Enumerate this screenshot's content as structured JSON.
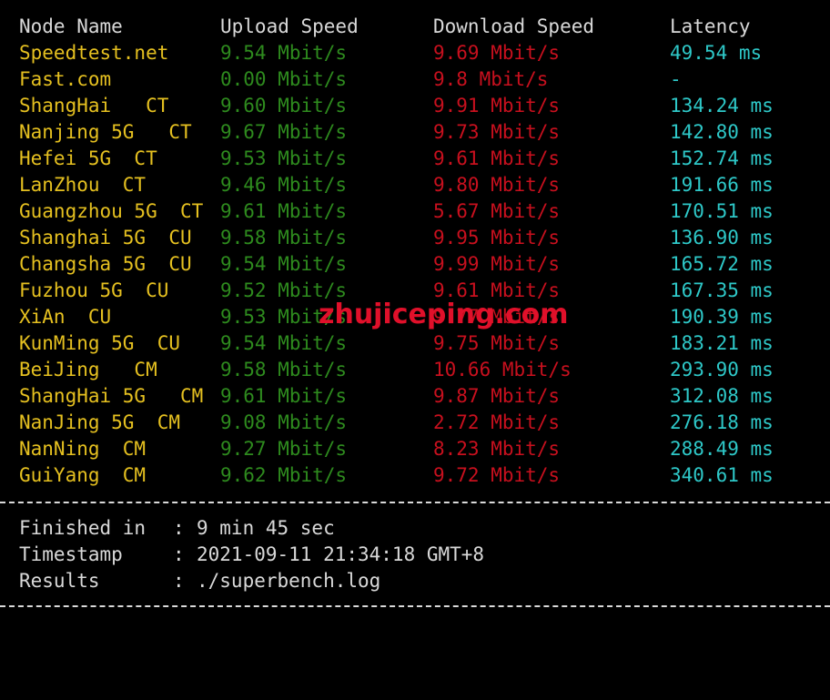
{
  "colors": {
    "background": "#000000",
    "header": "#d9d9d9",
    "node": "#e5c020",
    "upload": "#2e8b1e",
    "download": "#c8101e",
    "latency": "#2ec8c8",
    "summary": "#d9d9d9",
    "separator": "#d9d9d9",
    "watermark": "#e0102a"
  },
  "header": {
    "node": "Node Name",
    "upload": "Upload Speed",
    "download": "Download Speed",
    "latency": "Latency"
  },
  "rows": [
    {
      "node": "Speedtest.net",
      "upload": "9.54 Mbit/s",
      "download": "9.69 Mbit/s",
      "latency": "49.54 ms"
    },
    {
      "node": "Fast.com",
      "upload": "0.00 Mbit/s",
      "download": "9.8 Mbit/s",
      "latency": "-"
    },
    {
      "node": "ShangHai   CT",
      "upload": "9.60 Mbit/s",
      "download": "9.91 Mbit/s",
      "latency": "134.24 ms"
    },
    {
      "node": "Nanjing 5G   CT",
      "upload": "9.67 Mbit/s",
      "download": "9.73 Mbit/s",
      "latency": "142.80 ms"
    },
    {
      "node": "Hefei 5G  CT",
      "upload": "9.53 Mbit/s",
      "download": "9.61 Mbit/s",
      "latency": "152.74 ms"
    },
    {
      "node": "LanZhou  CT",
      "upload": "9.46 Mbit/s",
      "download": "9.80 Mbit/s",
      "latency": "191.66 ms"
    },
    {
      "node": "Guangzhou 5G  CT",
      "upload": "9.61 Mbit/s",
      "download": "5.67 Mbit/s",
      "latency": "170.51 ms"
    },
    {
      "node": "Shanghai 5G  CU",
      "upload": "9.58 Mbit/s",
      "download": "9.95 Mbit/s",
      "latency": "136.90 ms"
    },
    {
      "node": "Changsha 5G  CU",
      "upload": "9.54 Mbit/s",
      "download": "9.99 Mbit/s",
      "latency": "165.72 ms"
    },
    {
      "node": "Fuzhou 5G  CU",
      "upload": "9.52 Mbit/s",
      "download": "9.61 Mbit/s",
      "latency": "167.35 ms"
    },
    {
      "node": "XiAn  CU",
      "upload": "9.53 Mbit/s",
      "download": "9.77 Mbit/s",
      "latency": "190.39 ms"
    },
    {
      "node": "KunMing 5G  CU",
      "upload": "9.54 Mbit/s",
      "download": "9.75 Mbit/s",
      "latency": "183.21 ms"
    },
    {
      "node": "BeiJing   CM",
      "upload": "9.58 Mbit/s",
      "download": "10.66 Mbit/s",
      "latency": "293.90 ms"
    },
    {
      "node": "ShangHai 5G   CM",
      "upload": "9.61 Mbit/s",
      "download": "9.87 Mbit/s",
      "latency": "312.08 ms"
    },
    {
      "node": "NanJing 5G  CM",
      "upload": "9.08 Mbit/s",
      "download": "2.72 Mbit/s",
      "latency": "276.18 ms"
    },
    {
      "node": "NanNing  CM",
      "upload": "9.27 Mbit/s",
      "download": "8.23 Mbit/s",
      "latency": "288.49 ms"
    },
    {
      "node": "GuiYang  CM",
      "upload": "9.62 Mbit/s",
      "download": "9.72 Mbit/s",
      "latency": "340.61 ms"
    }
  ],
  "summary": [
    {
      "label": "Finished in",
      "colon": ":",
      "value": "9 min 45 sec"
    },
    {
      "label": "Timestamp",
      "colon": ":",
      "value": "2021-09-11 21:34:18 GMT+8"
    },
    {
      "label": "Results",
      "colon": ":",
      "value": "./superbench.log"
    }
  ],
  "watermark": "zhujiceping.com"
}
